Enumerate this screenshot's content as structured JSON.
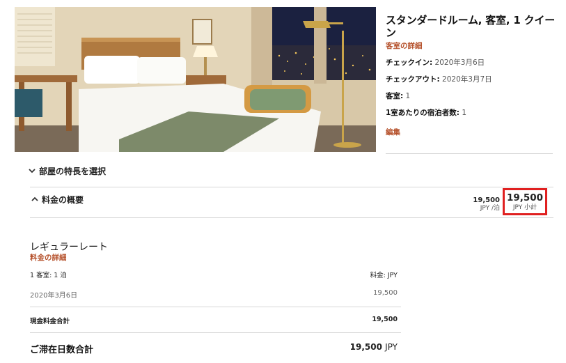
{
  "room": {
    "title": "スタンダードルーム, 客室, 1 クイーン",
    "details_link": "客室の詳細",
    "checkin_label": "チェックイン:",
    "checkin_value": "2020年3月6日",
    "checkout_label": "チェックアウト:",
    "checkout_value": "2020年3月7日",
    "rooms_label": "客室:",
    "rooms_value": "1",
    "guests_label": "1室あたりの宿泊者数:",
    "guests_value": "1",
    "edit_link": "編集"
  },
  "features": {
    "toggle_label": "部屋の特長を選択"
  },
  "rate_summary": {
    "toggle_label": "料金の概要",
    "per_night_amount": "19,500",
    "per_night_unit": "JPY /泊",
    "subtotal_amount": "19,500",
    "subtotal_unit": "JPY 小計"
  },
  "rate_details": {
    "rate_name": "レギュラーレート",
    "details_link": "料金の詳細",
    "header_left": "1 客室: 1 泊",
    "header_right": "料金: JPY",
    "date": "2020年3月6日",
    "date_amount": "19,500",
    "cash_total_label": "現金料金合計",
    "cash_total_amount": "19,500",
    "stay_total_label": "ご滞在日数合計",
    "stay_total_amount": "19,500",
    "stay_total_currency": "JPY"
  },
  "colors": {
    "accent": "#b5502a",
    "highlight_border": "#e02020",
    "divider": "#d6d6d6"
  }
}
